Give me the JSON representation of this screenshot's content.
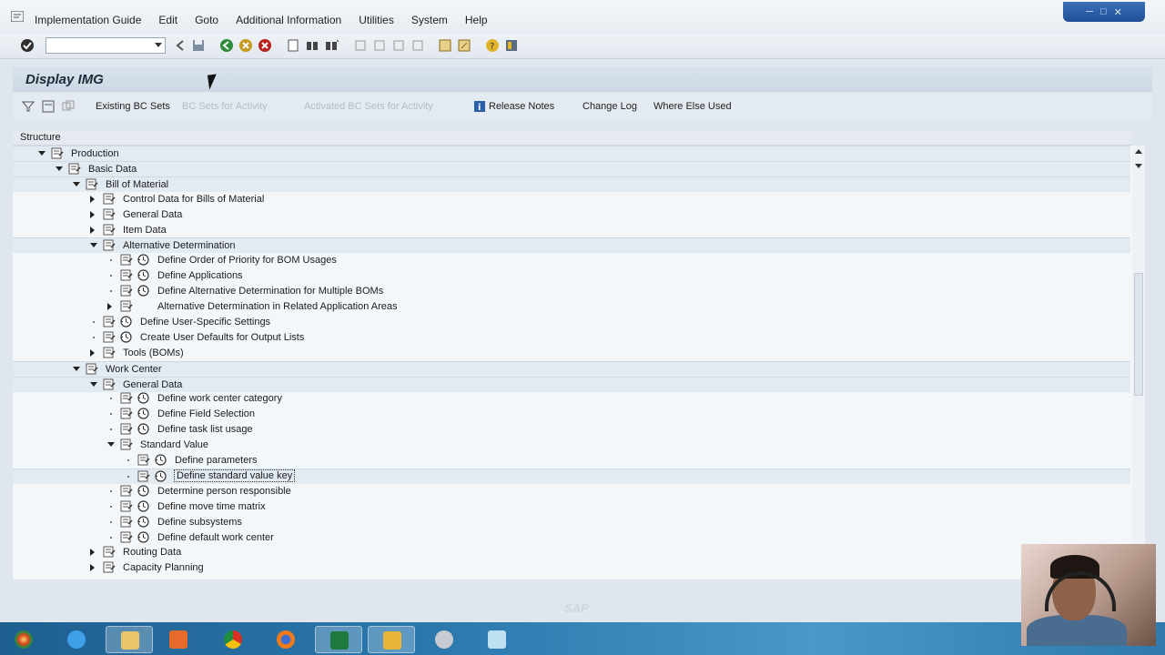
{
  "menubar": {
    "items": [
      "Implementation Guide",
      "Edit",
      "Goto",
      "Additional Information",
      "Utilities",
      "System",
      "Help"
    ]
  },
  "toolbar": {
    "command_field": ""
  },
  "screen_title": "Display IMG",
  "app_toolbar": {
    "existing_bc_sets": "Existing BC Sets",
    "bc_sets_activity": "BC Sets for Activity",
    "activated_bc_sets": "Activated BC Sets for Activity",
    "release_notes": "Release Notes",
    "change_log": "Change Log",
    "where_else_used": "Where Else Used"
  },
  "tree": {
    "header": "Structure",
    "rows": [
      {
        "label": "Production",
        "state": "open",
        "clock": false,
        "level": 0
      },
      {
        "label": "Basic Data",
        "state": "open",
        "clock": false,
        "level": 1
      },
      {
        "label": "Bill of Material",
        "state": "open",
        "clock": false,
        "level": 2
      },
      {
        "label": "Control Data for Bills of Material",
        "state": "closed",
        "clock": false,
        "level": 3
      },
      {
        "label": "General Data",
        "state": "closed",
        "clock": false,
        "level": 3
      },
      {
        "label": "Item Data",
        "state": "closed",
        "clock": false,
        "level": 3
      },
      {
        "label": "Alternative Determination",
        "state": "open",
        "clock": false,
        "level": 3
      },
      {
        "label": "Define Order of Priority for BOM Usages",
        "state": "leaf",
        "clock": true,
        "level": 4
      },
      {
        "label": "Define Applications",
        "state": "leaf",
        "clock": true,
        "level": 4
      },
      {
        "label": "Define Alternative Determination for Multiple BOMs",
        "state": "leaf",
        "clock": true,
        "level": 4
      },
      {
        "label": "Alternative Determination in Related Application Areas",
        "state": "closed",
        "clock": false,
        "level": 4
      },
      {
        "label": "Define User-Specific Settings",
        "state": "leaf",
        "clock": true,
        "level": 3
      },
      {
        "label": "Create User Defaults for Output Lists",
        "state": "leaf",
        "clock": true,
        "level": 3
      },
      {
        "label": "Tools (BOMs)",
        "state": "closed",
        "clock": false,
        "level": 3
      },
      {
        "label": "Work Center",
        "state": "open",
        "clock": false,
        "level": 2
      },
      {
        "label": "General Data",
        "state": "open",
        "clock": false,
        "level": 3
      },
      {
        "label": "Define work center category",
        "state": "leaf",
        "clock": true,
        "level": 4
      },
      {
        "label": "Define Field Selection",
        "state": "leaf",
        "clock": true,
        "level": 4
      },
      {
        "label": "Define task list usage",
        "state": "leaf",
        "clock": true,
        "level": 4
      },
      {
        "label": "Standard Value",
        "state": "open",
        "clock": false,
        "level": 4
      },
      {
        "label": "Define parameters",
        "state": "leaf",
        "clock": true,
        "level": 5
      },
      {
        "label": "Define standard value key",
        "state": "leaf",
        "clock": true,
        "level": 5,
        "selected": true
      },
      {
        "label": "Determine person responsible",
        "state": "leaf",
        "clock": true,
        "level": 4
      },
      {
        "label": "Define move time matrix",
        "state": "leaf",
        "clock": true,
        "level": 4
      },
      {
        "label": "Define subsystems",
        "state": "leaf",
        "clock": true,
        "level": 4
      },
      {
        "label": "Define default work center",
        "state": "leaf",
        "clock": true,
        "level": 4
      },
      {
        "label": "Routing Data",
        "state": "closed",
        "clock": false,
        "level": 3
      },
      {
        "label": "Capacity Planning",
        "state": "closed",
        "clock": false,
        "level": 3
      }
    ]
  },
  "statusbar": {
    "logo_text": "SAP"
  },
  "colors": {
    "background": "#dfe6ee",
    "title_bar": "#ccd8e4",
    "band_row": "#e2eaf2",
    "taskbar": "#2c7ab0"
  },
  "taskbar": {
    "apps": [
      "start-orb",
      "internet-explorer",
      "file-explorer",
      "media-player",
      "chrome",
      "firefox",
      "excel",
      "sap-logon",
      "network-tool",
      "notepad"
    ]
  }
}
